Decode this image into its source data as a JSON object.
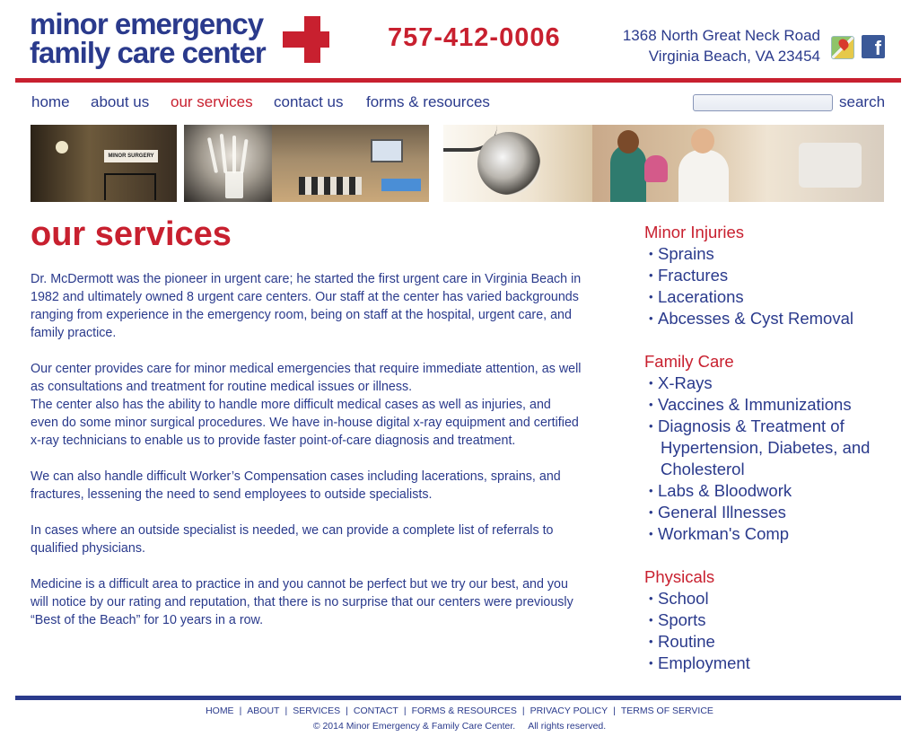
{
  "header": {
    "logo_line1": "minor emergency",
    "logo_line2": "family care center",
    "phone": "757-412-0006",
    "address_line1": "1368 North Great Neck Road",
    "address_line2": "Virginia Beach, VA 23454",
    "maps_icon": "google-maps-icon",
    "facebook_icon": "facebook-icon",
    "facebook_glyph": "f"
  },
  "nav": {
    "items": [
      {
        "label": "home",
        "active": false
      },
      {
        "label": "about us",
        "active": false
      },
      {
        "label": "our services",
        "active": true
      },
      {
        "label": "contact us",
        "active": false
      },
      {
        "label": "forms & resources",
        "active": false
      }
    ],
    "search_label": "search",
    "search_value": ""
  },
  "banner": {
    "sign_text": "MINOR SURGERY"
  },
  "main": {
    "title": "our services",
    "paragraphs": [
      "Dr. McDermott was the pioneer in urgent care; he started the first urgent care in Virginia Beach in 1982 and ultimately owned 8 urgent care centers. Our staff at the center has varied backgrounds ranging from experience in the emergency room, being on staff at the hospital, urgent care, and family practice.",
      "Our center provides care for minor medical emergencies that require immediate attention, as well as consultations and treatment for routine medical issues or illness.",
      "The center also has the ability to handle more difficult medical cases as well as injuries, and even do some minor surgical procedures. We have in-house digital x-ray equipment and certified x-ray technicians to enable us to provide faster point-of-care diagnosis and treatment.",
      "We can also handle difficult Worker’s Compensation cases including lacerations, sprains, and fractures, lessening the need to send employees to outside specialists.",
      "In cases where an outside specialist is needed, we can provide a complete list of referrals to qualified physicians.",
      "Medicine is a difficult area to practice in and you cannot be perfect but we try our best, and you will notice by our rating and reputation, that there is no surprise that our centers were previously “Best of the Beach” for 10 years in a row."
    ]
  },
  "sidebar": {
    "sections": [
      {
        "heading": "Minor Injuries",
        "items": [
          "Sprains",
          "Fractures",
          "Lacerations",
          "Abcesses & Cyst Removal"
        ]
      },
      {
        "heading": "Family Care",
        "items": [
          "X-Rays",
          "Vaccines & Immunizations",
          "Diagnosis & Treatment of",
          "Labs & Bloodwork",
          "General Illnesses",
          "Workman's Comp"
        ],
        "wrap_lines": [
          "Hypertension, Diabetes, and",
          "Cholesterol"
        ]
      },
      {
        "heading": "Physicals",
        "items": [
          "School",
          "Sports",
          "Routine",
          "Employment"
        ]
      }
    ]
  },
  "footer": {
    "links": [
      "HOME",
      "ABOUT",
      "SERVICES",
      "CONTACT",
      "FORMS & RESOURCES",
      "PRIVACY POLICY",
      "TERMS OF SERVICE"
    ],
    "separator": "|",
    "copyright": "© 2014 Minor Emergency & Family Care Center.     All rights reserved."
  },
  "colors": {
    "brand_blue": "#2a3a8c",
    "brand_red": "#c8202f"
  }
}
